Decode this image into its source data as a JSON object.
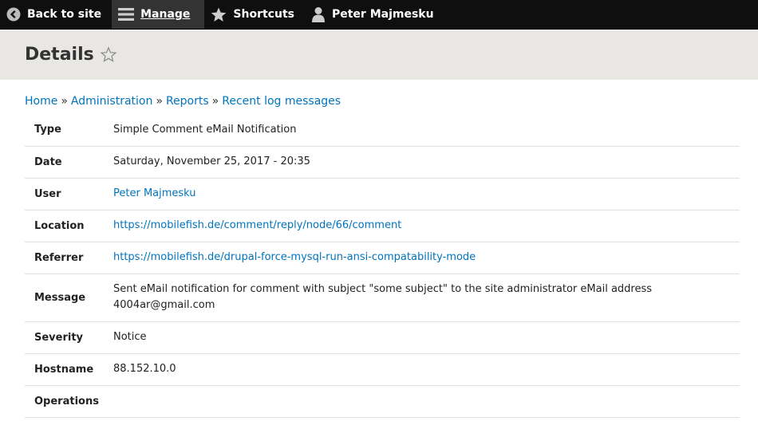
{
  "toolbar": {
    "back_label": "Back to site",
    "manage_label": "Manage",
    "shortcuts_label": "Shortcuts",
    "user_label": "Peter Majmesku"
  },
  "page": {
    "title": "Details"
  },
  "breadcrumb": [
    {
      "label": "Home"
    },
    {
      "label": "Administration"
    },
    {
      "label": "Reports"
    },
    {
      "label": "Recent log messages"
    }
  ],
  "details": {
    "type": {
      "label": "Type",
      "value": "Simple Comment eMail Notification"
    },
    "date": {
      "label": "Date",
      "value": "Saturday, November 25, 2017 - 20:35"
    },
    "user": {
      "label": "User",
      "value": "Peter Majmesku"
    },
    "location": {
      "label": "Location",
      "value": "https://mobilefish.de/comment/reply/node/66/comment"
    },
    "referrer": {
      "label": "Referrer",
      "value": "https://mobilefish.de/drupal-force-mysql-run-ansi-compatability-mode"
    },
    "message": {
      "label": "Message",
      "line1": "Sent eMail notification for comment with subject \"some subject\" to the site administrator eMail address",
      "line2": "4004ar@gmail.com"
    },
    "severity": {
      "label": "Severity",
      "value": "Notice"
    },
    "hostname": {
      "label": "Hostname",
      "value": "88.152.10.0"
    },
    "operations": {
      "label": "Operations",
      "value": ""
    }
  },
  "colors": {
    "toolbar_bg": "#0f0f0f",
    "header_bg": "#e8e7e3",
    "link": "#0074bd"
  }
}
